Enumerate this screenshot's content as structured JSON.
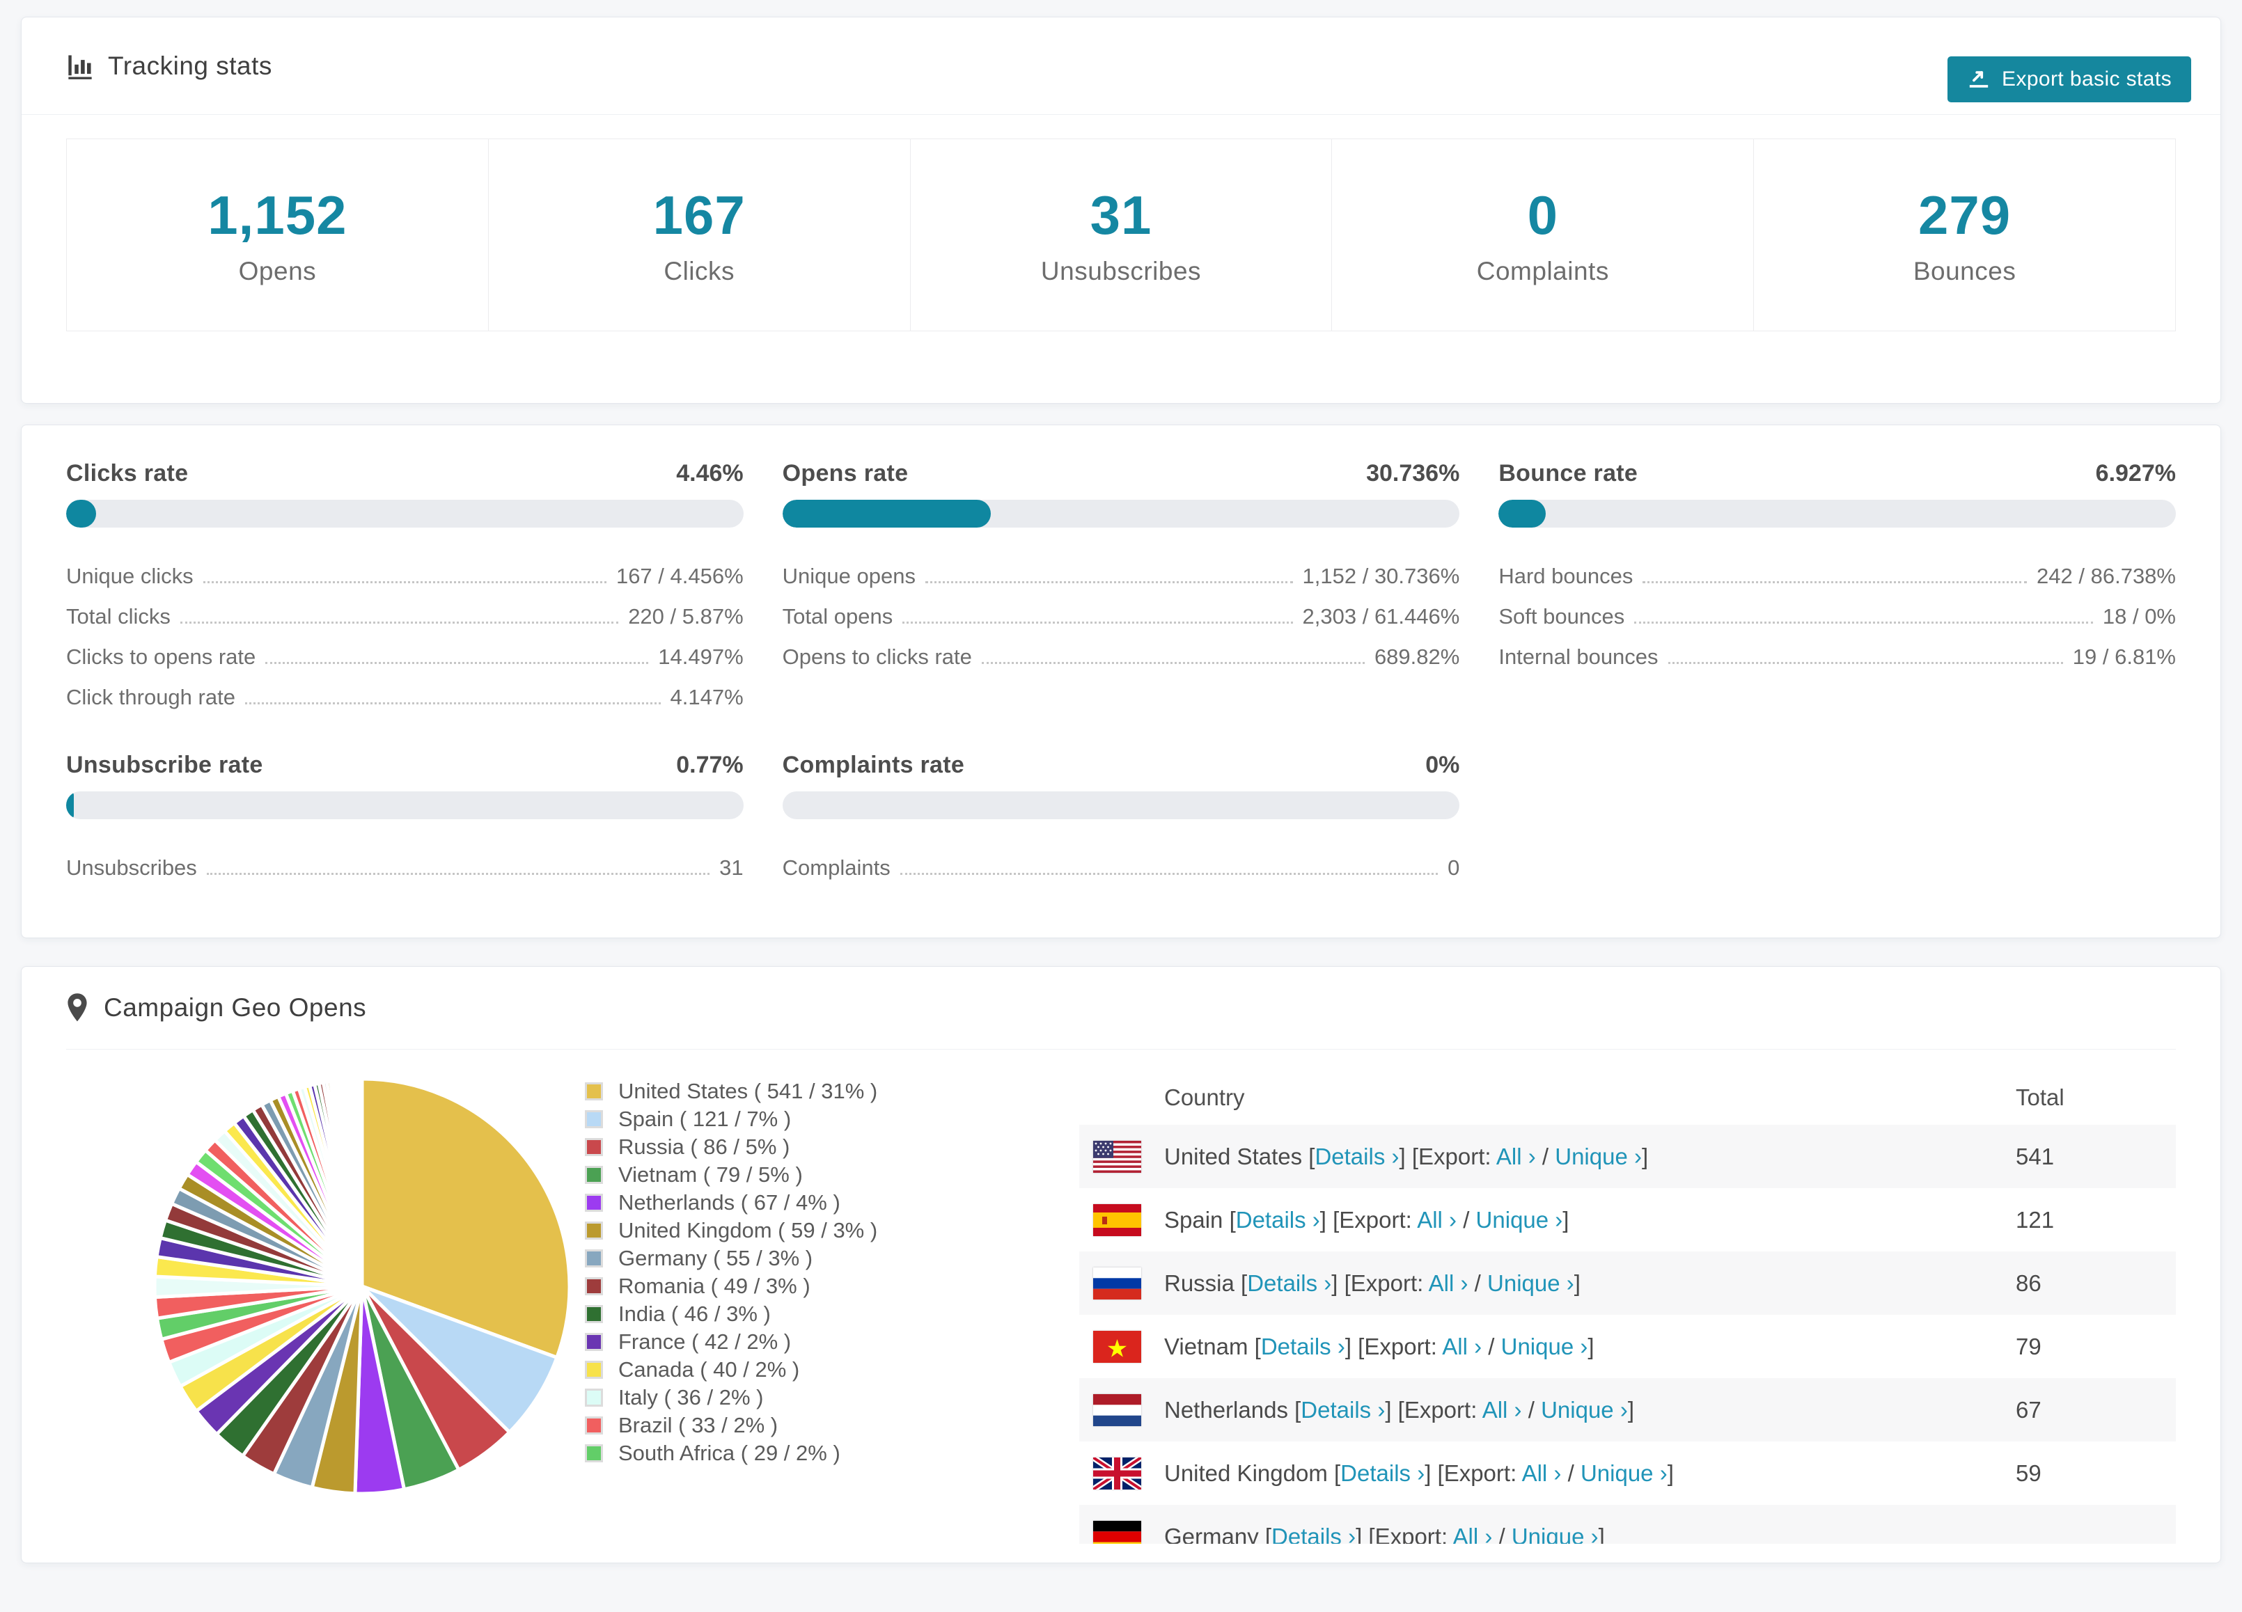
{
  "accent": "#15879e",
  "link_color": "#2094b8",
  "tracking": {
    "title": "Tracking stats",
    "export_button": "Export basic stats",
    "stats": [
      {
        "value": "1,152",
        "label": "Opens"
      },
      {
        "value": "167",
        "label": "Clicks"
      },
      {
        "value": "31",
        "label": "Unsubscribes"
      },
      {
        "value": "0",
        "label": "Complaints"
      },
      {
        "value": "279",
        "label": "Bounces"
      }
    ]
  },
  "rates": {
    "row1": [
      {
        "title": "Clicks rate",
        "value": "4.46%",
        "bar_pct": 4.46,
        "rows": [
          {
            "label": "Unique clicks",
            "value": "167 / 4.456%"
          },
          {
            "label": "Total clicks",
            "value": "220 / 5.87%"
          },
          {
            "label": "Clicks to opens rate",
            "value": "14.497%"
          },
          {
            "label": "Click through rate",
            "value": "4.147%"
          }
        ]
      },
      {
        "title": "Opens rate",
        "value": "30.736%",
        "bar_pct": 30.736,
        "rows": [
          {
            "label": "Unique opens",
            "value": "1,152 / 30.736%"
          },
          {
            "label": "Total opens",
            "value": "2,303 / 61.446%"
          },
          {
            "label": "Opens to clicks rate",
            "value": "689.82%"
          }
        ]
      },
      {
        "title": "Bounce rate",
        "value": "6.927%",
        "bar_pct": 6.927,
        "rows": [
          {
            "label": "Hard bounces",
            "value": "242 / 86.738%"
          },
          {
            "label": "Soft bounces",
            "value": "18 / 0%"
          },
          {
            "label": "Internal bounces",
            "value": "19 / 6.81%"
          }
        ]
      }
    ],
    "row2": [
      {
        "title": "Unsubscribe rate",
        "value": "0.77%",
        "bar_pct": 0.77,
        "rows": [
          {
            "label": "Unsubscribes",
            "value": "31"
          }
        ]
      },
      {
        "title": "Complaints rate",
        "value": "0%",
        "bar_pct": 0,
        "rows": [
          {
            "label": "Complaints",
            "value": "0"
          }
        ]
      }
    ]
  },
  "geo": {
    "title": "Campaign Geo Opens",
    "table_headers": {
      "country": "Country",
      "total": "Total"
    },
    "link_parts": {
      "bracket_open": "[",
      "bracket_close": "]",
      "details": "Details ›",
      "export_prefix": "Export:",
      "all": "All ›",
      "slash": "/",
      "unique": "Unique ›"
    },
    "table_rows": [
      {
        "code": "us",
        "country": "United States",
        "total": "541"
      },
      {
        "code": "es",
        "country": "Spain",
        "total": "121"
      },
      {
        "code": "ru",
        "country": "Russia",
        "total": "86"
      },
      {
        "code": "vn",
        "country": "Vietnam",
        "total": "79"
      },
      {
        "code": "nl",
        "country": "Netherlands",
        "total": "67"
      },
      {
        "code": "gb",
        "country": "United Kingdom",
        "total": "59"
      },
      {
        "code": "de",
        "country": "Germany",
        "total": "",
        "partial": true
      }
    ]
  },
  "chart_data": {
    "type": "pie",
    "title": "Campaign Geo Opens",
    "legend_position": "right",
    "categories": [
      "United States",
      "Spain",
      "Russia",
      "Vietnam",
      "Netherlands",
      "United Kingdom",
      "Germany",
      "Romania",
      "India",
      "France",
      "Canada",
      "Italy",
      "Brazil",
      "South Africa"
    ],
    "values": [
      541,
      121,
      86,
      79,
      67,
      59,
      55,
      49,
      46,
      42,
      40,
      36,
      33,
      29
    ],
    "percents": [
      31,
      7,
      5,
      5,
      4,
      3,
      3,
      3,
      3,
      2,
      2,
      2,
      2,
      2
    ],
    "legend_labels": [
      "United States ( 541 / 31% )",
      "Spain ( 121 / 7% )",
      "Russia ( 86 / 5% )",
      "Vietnam ( 79 / 5% )",
      "Netherlands ( 67 / 4% )",
      "United Kingdom ( 59 / 3% )",
      "Germany ( 55 / 3% )",
      "Romania ( 49 / 3% )",
      "India ( 46 / 3% )",
      "France ( 42 / 2% )",
      "Canada ( 40 / 2% )",
      "Italy ( 36 / 2% )",
      "Brazil ( 33 / 2% )",
      "South Africa ( 29 / 2% )"
    ],
    "colors": [
      "#e4c04c",
      "#b8d9f5",
      "#c9484c",
      "#4ba153",
      "#9c3bf0",
      "#bb9a2e",
      "#87a7bf",
      "#9e3c3c",
      "#2f7031",
      "#6a35b2",
      "#f7e24b",
      "#dcfcf6",
      "#f15f5f",
      "#62ce68"
    ],
    "others_estimated": {
      "values": [
        29,
        28,
        27,
        26,
        25,
        24,
        23,
        22,
        21,
        20,
        19,
        18,
        17,
        16,
        15,
        14,
        13,
        12,
        11,
        10,
        9,
        8,
        7,
        7,
        6,
        6,
        5,
        5,
        4,
        4,
        3,
        3,
        3,
        3,
        2,
        2,
        2,
        2,
        2,
        1,
        1,
        1,
        1,
        1,
        1,
        1,
        1,
        1,
        1,
        1,
        1,
        1
      ],
      "palette": [
        "#f15f5f",
        "#e8fcf8",
        "#fbe84e",
        "#5b35ad",
        "#2f7031",
        "#933a3a",
        "#7d9cb1",
        "#a98e26",
        "#e34ff2",
        "#6fde6f"
      ]
    }
  }
}
